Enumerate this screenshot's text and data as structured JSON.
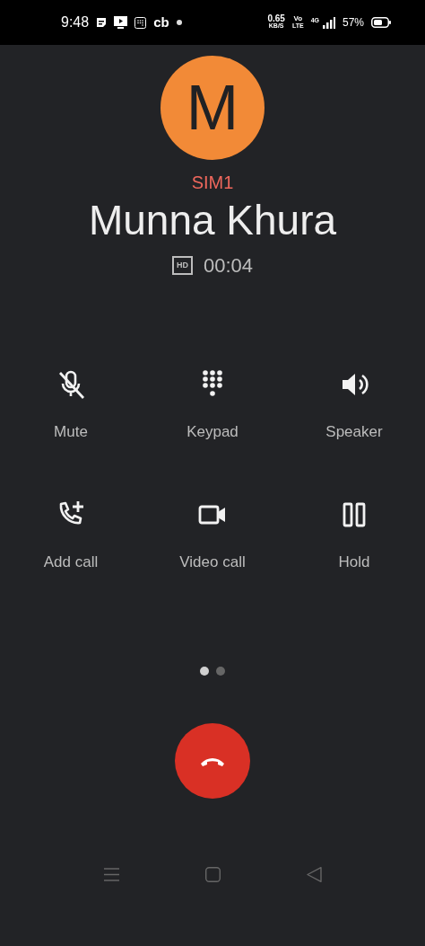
{
  "status_bar": {
    "time": "9:48",
    "app_text": "cb",
    "net_speed": {
      "value": "0.65",
      "unit": "KB/S"
    },
    "volte": {
      "top": "Vo",
      "bottom": "LTE"
    },
    "network": "4G",
    "battery": "57%"
  },
  "caller": {
    "initial": "M",
    "sim": "SIM1",
    "name": "Munna Khura",
    "hd_label": "HD",
    "duration": "00:04"
  },
  "actions": [
    {
      "kind": "mute",
      "label": "Mute"
    },
    {
      "kind": "keypad",
      "label": "Keypad"
    },
    {
      "kind": "speaker",
      "label": "Speaker"
    },
    {
      "kind": "add_call",
      "label": "Add call"
    },
    {
      "kind": "video",
      "label": "Video call"
    },
    {
      "kind": "hold",
      "label": "Hold"
    }
  ],
  "pages": [
    {
      "selected": true
    },
    {
      "selected": false
    }
  ]
}
